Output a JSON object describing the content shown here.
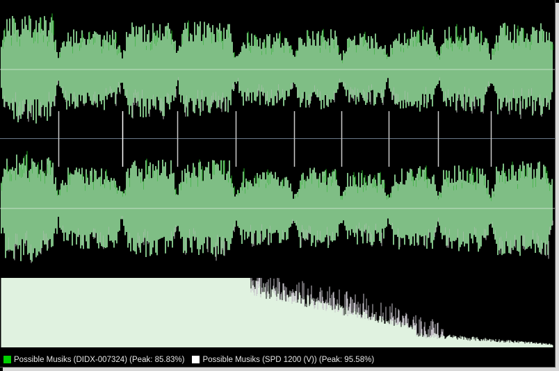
{
  "legend": {
    "items": [
      {
        "label": "Possible Musiks (DIDX-007324) (Peak: 85.83%)",
        "color": "#00d000"
      },
      {
        "label": "Possible Musiks (SPD 1200 (V)) (Peak: 95.58%)",
        "color": "#ffffff"
      }
    ]
  },
  "colors": {
    "background": "#000000",
    "waveform_fill": "#7fbe85",
    "waveform_highlight": "#22b022",
    "waveform_secondary": "#bdbdbd",
    "center_line": "#d8e8d8",
    "separator": "#6a7a8a",
    "spectrum_fill": "#e0f2e0",
    "spectrum_secondary": "#c8c4cc"
  },
  "tracks": {
    "segment_boundaries_pct": [
      10.5,
      22.0,
      32.0,
      42.5,
      53.0,
      61.5,
      70.0,
      79.0,
      88.5
    ],
    "segment_levels": [
      0.82,
      0.62,
      0.74,
      0.74,
      0.56,
      0.62,
      0.56,
      0.64,
      0.66,
      0.72,
      0.48
    ]
  }
}
